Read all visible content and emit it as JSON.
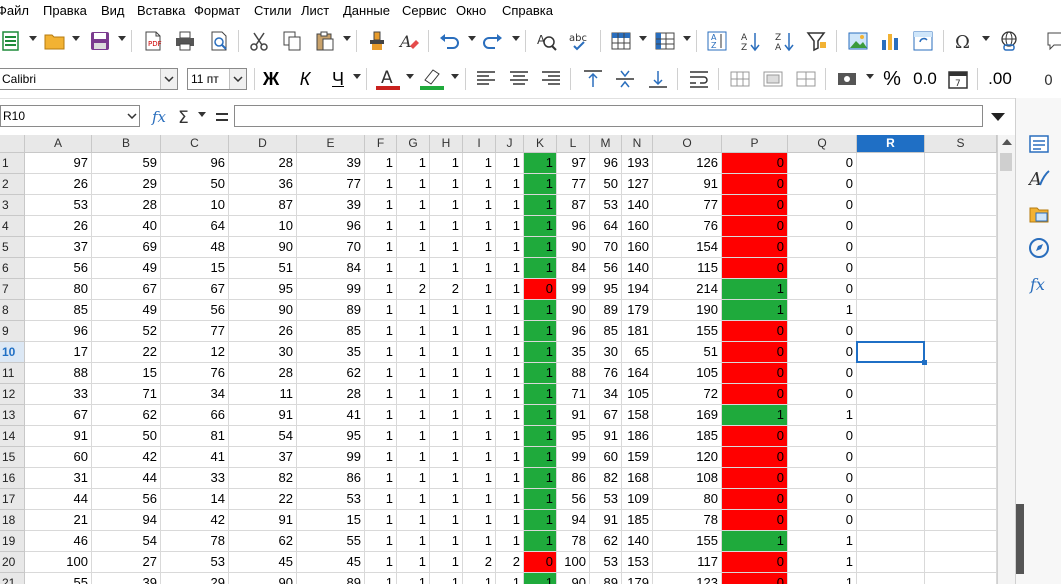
{
  "menu": [
    "Файл",
    "Правка",
    "Вид",
    "Вставка",
    "Формат",
    "Стили",
    "Лист",
    "Данные",
    "Сервис",
    "Окно",
    "Справка"
  ],
  "toolbar2": {
    "font_name": "Calibri",
    "font_size": "11 пт",
    "bold": "Ж",
    "italic": "К",
    "underline": "Ч",
    "percent": "%",
    "format_decimal": "0.0",
    "add_decimal": ".00"
  },
  "formula_bar": {
    "name_box": "R10",
    "formula": ""
  },
  "columns": [
    "A",
    "B",
    "C",
    "D",
    "E",
    "F",
    "G",
    "H",
    "I",
    "J",
    "K",
    "L",
    "M",
    "N",
    "O",
    "P",
    "Q",
    "R",
    "S"
  ],
  "selected_column": "R",
  "selected_row": 10,
  "row_numbers": [
    1,
    2,
    3,
    4,
    5,
    6,
    7,
    8,
    9,
    10,
    11,
    12,
    13,
    14,
    15,
    16,
    17,
    18,
    19,
    20,
    21
  ],
  "rows": [
    {
      "v": [
        "97",
        "59",
        "96",
        "28",
        "39",
        "1",
        "1",
        "1",
        "1",
        "1",
        "1",
        "97",
        "96",
        "193",
        "126",
        "0",
        "0"
      ],
      "k": "green",
      "p": "red"
    },
    {
      "v": [
        "26",
        "29",
        "50",
        "36",
        "77",
        "1",
        "1",
        "1",
        "1",
        "1",
        "1",
        "77",
        "50",
        "127",
        "91",
        "0",
        "0"
      ],
      "k": "green",
      "p": "red"
    },
    {
      "v": [
        "53",
        "28",
        "10",
        "87",
        "39",
        "1",
        "1",
        "1",
        "1",
        "1",
        "1",
        "87",
        "53",
        "140",
        "77",
        "0",
        "0"
      ],
      "k": "green",
      "p": "red"
    },
    {
      "v": [
        "26",
        "40",
        "64",
        "10",
        "96",
        "1",
        "1",
        "1",
        "1",
        "1",
        "1",
        "96",
        "64",
        "160",
        "76",
        "0",
        "0"
      ],
      "k": "green",
      "p": "red"
    },
    {
      "v": [
        "37",
        "69",
        "48",
        "90",
        "70",
        "1",
        "1",
        "1",
        "1",
        "1",
        "1",
        "90",
        "70",
        "160",
        "154",
        "0",
        "0"
      ],
      "k": "green",
      "p": "red"
    },
    {
      "v": [
        "56",
        "49",
        "15",
        "51",
        "84",
        "1",
        "1",
        "1",
        "1",
        "1",
        "1",
        "84",
        "56",
        "140",
        "115",
        "0",
        "0"
      ],
      "k": "green",
      "p": "red"
    },
    {
      "v": [
        "80",
        "67",
        "67",
        "95",
        "99",
        "1",
        "2",
        "2",
        "1",
        "1",
        "0",
        "99",
        "95",
        "194",
        "214",
        "1",
        "0"
      ],
      "k": "red",
      "p": "green"
    },
    {
      "v": [
        "85",
        "49",
        "56",
        "90",
        "89",
        "1",
        "1",
        "1",
        "1",
        "1",
        "1",
        "90",
        "89",
        "179",
        "190",
        "1",
        "1"
      ],
      "k": "green",
      "p": "green"
    },
    {
      "v": [
        "96",
        "52",
        "77",
        "26",
        "85",
        "1",
        "1",
        "1",
        "1",
        "1",
        "1",
        "96",
        "85",
        "181",
        "155",
        "0",
        "0"
      ],
      "k": "green",
      "p": "red"
    },
    {
      "v": [
        "17",
        "22",
        "12",
        "30",
        "35",
        "1",
        "1",
        "1",
        "1",
        "1",
        "1",
        "35",
        "30",
        "65",
        "51",
        "0",
        "0"
      ],
      "k": "green",
      "p": "red"
    },
    {
      "v": [
        "88",
        "15",
        "76",
        "28",
        "62",
        "1",
        "1",
        "1",
        "1",
        "1",
        "1",
        "88",
        "76",
        "164",
        "105",
        "0",
        "0"
      ],
      "k": "green",
      "p": "red"
    },
    {
      "v": [
        "33",
        "71",
        "34",
        "11",
        "28",
        "1",
        "1",
        "1",
        "1",
        "1",
        "1",
        "71",
        "34",
        "105",
        "72",
        "0",
        "0"
      ],
      "k": "green",
      "p": "red"
    },
    {
      "v": [
        "67",
        "62",
        "66",
        "91",
        "41",
        "1",
        "1",
        "1",
        "1",
        "1",
        "1",
        "91",
        "67",
        "158",
        "169",
        "1",
        "1"
      ],
      "k": "green",
      "p": "green"
    },
    {
      "v": [
        "91",
        "50",
        "81",
        "54",
        "95",
        "1",
        "1",
        "1",
        "1",
        "1",
        "1",
        "95",
        "91",
        "186",
        "185",
        "0",
        "0"
      ],
      "k": "green",
      "p": "red"
    },
    {
      "v": [
        "60",
        "42",
        "41",
        "37",
        "99",
        "1",
        "1",
        "1",
        "1",
        "1",
        "1",
        "99",
        "60",
        "159",
        "120",
        "0",
        "0"
      ],
      "k": "green",
      "p": "red"
    },
    {
      "v": [
        "31",
        "44",
        "33",
        "82",
        "86",
        "1",
        "1",
        "1",
        "1",
        "1",
        "1",
        "86",
        "82",
        "168",
        "108",
        "0",
        "0"
      ],
      "k": "green",
      "p": "red"
    },
    {
      "v": [
        "44",
        "56",
        "14",
        "22",
        "53",
        "1",
        "1",
        "1",
        "1",
        "1",
        "1",
        "56",
        "53",
        "109",
        "80",
        "0",
        "0"
      ],
      "k": "green",
      "p": "red"
    },
    {
      "v": [
        "21",
        "94",
        "42",
        "91",
        "15",
        "1",
        "1",
        "1",
        "1",
        "1",
        "1",
        "94",
        "91",
        "185",
        "78",
        "0",
        "0"
      ],
      "k": "green",
      "p": "red"
    },
    {
      "v": [
        "46",
        "54",
        "78",
        "62",
        "55",
        "1",
        "1",
        "1",
        "1",
        "1",
        "1",
        "78",
        "62",
        "140",
        "155",
        "1",
        "1"
      ],
      "k": "green",
      "p": "green"
    },
    {
      "v": [
        "100",
        "27",
        "53",
        "45",
        "45",
        "1",
        "1",
        "1",
        "2",
        "2",
        "0",
        "100",
        "53",
        "153",
        "117",
        "0",
        "1"
      ],
      "k": "red",
      "p": "red"
    },
    {
      "v": [
        "55",
        "39",
        "29",
        "90",
        "89",
        "1",
        "1",
        "1",
        "1",
        "1",
        "1",
        "90",
        "89",
        "179",
        "123",
        "0",
        "1"
      ],
      "k": "green",
      "p": "red"
    }
  ],
  "colors": {
    "true_fill": "#1faa3c",
    "false_fill": "#ff0000",
    "selection": "#1f6fc5"
  },
  "icons": {
    "toolbar1": [
      "new-spreadsheet-icon",
      "open-folder-icon",
      "save-icon",
      "export-pdf-icon",
      "print-icon",
      "print-preview-icon",
      "cut-icon",
      "copy-icon",
      "paste-icon",
      "clone-formatting-icon",
      "clear-formatting-icon",
      "undo-icon",
      "redo-icon",
      "find-replace-icon",
      "spelling-icon",
      "row-icon",
      "column-icon",
      "sort-ascending-az-icon",
      "sort-ascending-icon",
      "sort-descending-icon",
      "autofilter-icon",
      "insert-image-icon",
      "insert-chart-icon",
      "pivot-table-icon",
      "special-character-icon",
      "hyperlink-icon"
    ],
    "sidebar": [
      "properties-icon",
      "styles-icon",
      "gallery-icon",
      "navigator-icon",
      "functions-icon"
    ]
  }
}
